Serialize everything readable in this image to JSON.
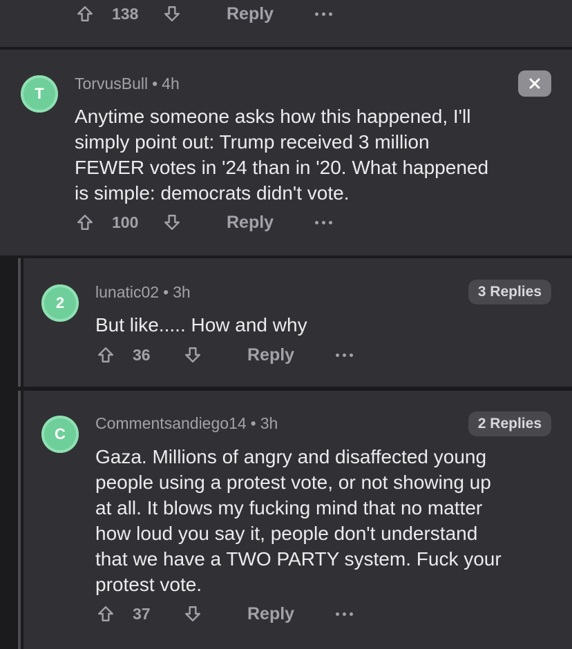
{
  "top_actions": {
    "score": "138",
    "reply_label": "Reply"
  },
  "comments": [
    {
      "avatar_letter": "T",
      "username": "TorvusBull",
      "separator": "•",
      "time": "4h",
      "lines": [
        "Anytime someone asks how this happened, I'll",
        "simply point out: Trump received 3 million",
        "FEWER votes in '24 than in '20. What happened",
        "is simple: democrats didn't vote."
      ],
      "score": "100",
      "reply_label": "Reply"
    },
    {
      "avatar_letter": "2",
      "username": "lunatic02",
      "separator": "•",
      "time": "3h",
      "replies_badge": "3 Replies",
      "lines": [
        "But like..... How and why"
      ],
      "score": "36",
      "reply_label": "Reply"
    },
    {
      "avatar_letter": "C",
      "username": "Commentsandiego14",
      "separator": "•",
      "time": "3h",
      "replies_badge": "2 Replies",
      "lines": [
        "Gaza. Millions of angry and disaffected young",
        "people using a protest vote, or not showing up",
        "at all. It blows my fucking mind that no matter",
        "how loud you say it, people don't understand",
        "that we have a TWO PARTY system. Fuck your",
        "protest vote."
      ],
      "score": "37",
      "reply_label": "Reply"
    }
  ],
  "colors": {
    "card": "#313135",
    "background": "#1b1b1e",
    "avatar": "#6fcf9a",
    "muted_text": "#a2a2a8"
  },
  "icons": [
    "upvote-icon",
    "downvote-icon",
    "more-options-icon",
    "close-icon"
  ]
}
